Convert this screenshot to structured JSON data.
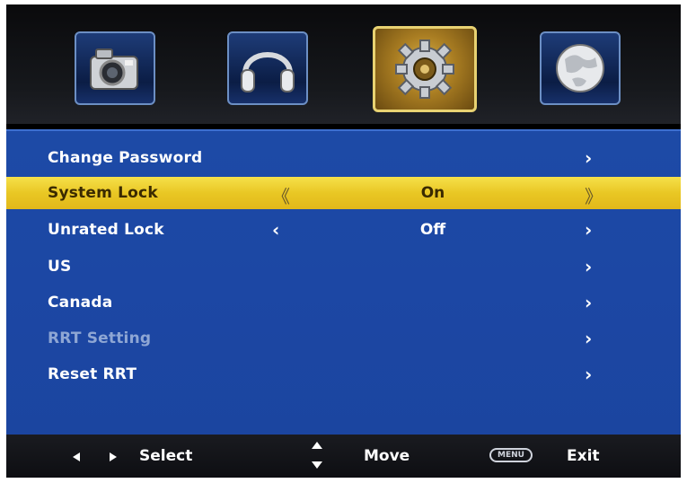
{
  "top_icons": [
    {
      "name": "camera-icon",
      "active": false
    },
    {
      "name": "headphones-icon",
      "active": false
    },
    {
      "name": "gear-icon",
      "active": true
    },
    {
      "name": "globe-icon",
      "active": false
    }
  ],
  "menu": {
    "items": [
      {
        "label": "Change Password",
        "value": "",
        "left_arrow": "",
        "right_arrow": "›",
        "state": "normal"
      },
      {
        "label": "System Lock",
        "value": "On",
        "left_arrow": "《",
        "right_arrow": "》",
        "state": "selected"
      },
      {
        "label": "Unrated Lock",
        "value": "Off",
        "left_arrow": "‹",
        "right_arrow": "›",
        "state": "normal"
      },
      {
        "label": "US",
        "value": "",
        "left_arrow": "",
        "right_arrow": "›",
        "state": "normal"
      },
      {
        "label": "Canada",
        "value": "",
        "left_arrow": "",
        "right_arrow": "›",
        "state": "normal"
      },
      {
        "label": "RRT Setting",
        "value": "",
        "left_arrow": "",
        "right_arrow": "›",
        "state": "disabled"
      },
      {
        "label": "Reset RRT",
        "value": "",
        "left_arrow": "",
        "right_arrow": "›",
        "state": "normal"
      }
    ]
  },
  "footer": {
    "select_label": "Select",
    "move_label": "Move",
    "menu_key": "MENU",
    "exit_label": "Exit"
  },
  "colors": {
    "menu_bg": "#1c47a4",
    "highlight": "#ebc82a",
    "active_tile": "#d8b14a"
  }
}
